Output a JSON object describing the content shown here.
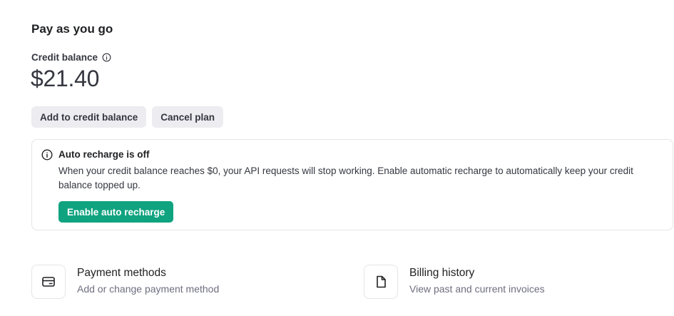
{
  "header": {
    "title": "Pay as you go"
  },
  "balance": {
    "label": "Credit balance",
    "info_icon": "info-circle-icon",
    "amount": "$21.40"
  },
  "actions": {
    "add_credit_label": "Add to credit balance",
    "cancel_plan_label": "Cancel plan"
  },
  "auto_recharge": {
    "icon": "info-circle-icon",
    "title": "Auto recharge is off",
    "body": "When your credit balance reaches $0, your API requests will stop working. Enable automatic recharge to automatically keep your credit balance topped up.",
    "enable_label": "Enable auto recharge"
  },
  "cards": {
    "payment_methods": {
      "icon": "credit-card-icon",
      "title": "Payment methods",
      "subtitle": "Add or change payment method"
    },
    "billing_history": {
      "icon": "document-icon",
      "title": "Billing history",
      "subtitle": "View past and current invoices"
    }
  },
  "colors": {
    "accent_green": "#10a37f",
    "button_gray": "#ececf1",
    "text_primary": "#202123",
    "text_secondary": "#6e6e80",
    "border": "#e5e5e5"
  }
}
